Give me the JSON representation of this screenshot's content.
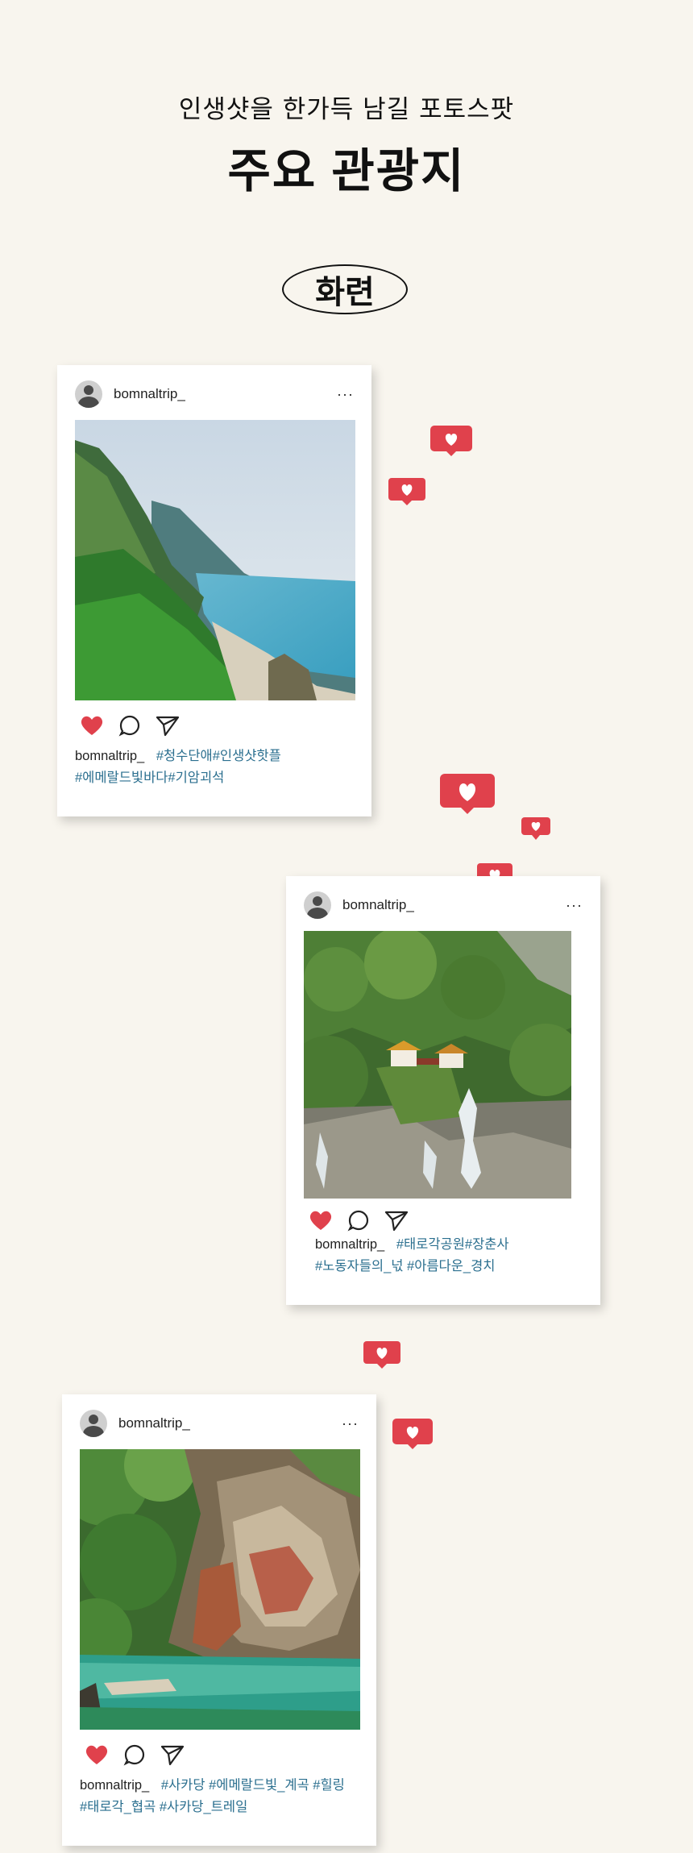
{
  "header": {
    "subtitle": "인생샷을 한가득 남길 포토스팟",
    "title": "주요 관광지",
    "region": "화련"
  },
  "posts": [
    {
      "username": "bomnaltrip_",
      "caption_user": "bomnaltrip_",
      "caption_tags_line1": "#청수단애#인생샷핫플",
      "caption_tags_line2": "#에메랄드빛바다#기암괴석",
      "more": "···"
    },
    {
      "username": "bomnaltrip_",
      "caption_user": "bomnaltrip_",
      "caption_tags_line1": "#태로각공원#장춘사",
      "caption_tags_line2": "#노동자들의_넋 #아름다운_경치",
      "more": "···"
    },
    {
      "username": "bomnaltrip_",
      "caption_user": "bomnaltrip_",
      "caption_tags_line1": "#사카당 #에메랄드빛_계곡 #힐링",
      "caption_tags_line2": "#태로각_협곡 #사카당_트레일",
      "more": "···"
    }
  ],
  "colors": {
    "background": "#f8f5ee",
    "heart_red": "#e0414c",
    "hashtag": "#2b6f8f"
  },
  "icons": [
    "heart-icon",
    "comment-icon",
    "send-icon",
    "more-icon",
    "avatar",
    "like-bubble"
  ]
}
